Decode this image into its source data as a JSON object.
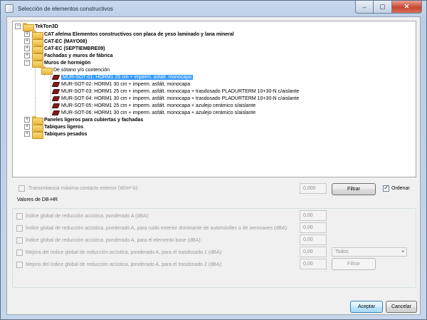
{
  "window": {
    "title": "Selección de elementos constructivos",
    "min_glyph": "–",
    "max_glyph": "▢",
    "close_glyph": "✕"
  },
  "tree": {
    "root": "TekTon3D",
    "categories": [
      "CAT afelma Elementos constructivos con placa de yeso laminado y lana mineral",
      "CAT-EC (MAYO08)",
      "CAT-EC (SEPTIEMBRE09)",
      "Fachadas y muros de fábrica",
      "Muros de hormigón"
    ],
    "subfolder": "De sótano y/o contención",
    "items": [
      "MUR-SOT-01: HORM1 25 cm + imperm. asfált. monocapa",
      "MUR-SOT-02: HORM1 30 cm + imperm. asfált. monocapa",
      "MUR-SOT-03: HORM1 25 cm + imperm. asfált. monocapa + trasdosado PLADURTERM 10+30-N c/aislante",
      "MUR-SOT-04: HORM1 30 cm + imperm. asfált. monocapa + trasdosado PLADURTERM 10+30-N c/aislante",
      "MUR-SOT-05: HORM1 25 cm + imperm. asfált. monocapa + azulejo cerámico s/aislante",
      "MUR-SOT-06: HORM1 30 cm + imperm. asfált. monocapa + azulejo cerámico s/aislante"
    ],
    "categories_after": [
      "Paneles ligeros para cubiertas y fachadas",
      "Tabiques ligeros",
      "Tabiques pesados"
    ],
    "expander_plus": "+",
    "expander_minus": "−"
  },
  "filter": {
    "transmitancia_label": "Transmitancia máxima contacto exterior (W/m²·k):",
    "transmitancia_value": "0,000",
    "filter_button": "Filtrar",
    "order_label": "Ordenar",
    "order_checked": true
  },
  "dbhr": {
    "group_title": "Valores de DB-HR",
    "rows": [
      {
        "label": "Índice global de reducción acústica, ponderado A (dBA):",
        "value": "0,00"
      },
      {
        "label": "Índice global de reducción acústica, ponderado A, para ruido exterior dominante de automóviles  o de aeronaves (dBA):",
        "value": "0,00"
      },
      {
        "label": "Índice global de reducción acústica, ponderado A, para el elemento base (dBA):",
        "value": "0,00"
      },
      {
        "label": "Mejora del índice global de reducción acústica, ponderado A, para el trasdosado 1 (dBA):",
        "value": "0,00"
      },
      {
        "label": "Mejora del índice global de reducción acústica, ponderado A, para el trasdosado 2 (dBA):",
        "value": "0,00"
      }
    ],
    "select_value": "Todos",
    "filter_button": "Filtrar"
  },
  "footer": {
    "accept_button": "Aceptar",
    "cancel_button": "Cancelar"
  },
  "colors": {
    "selection": "#3399ff",
    "item_icon": "#7b1c1c",
    "folder": "#f8dc7c"
  },
  "icons": {
    "folder": "folder-icon",
    "item": "construction-element-icon",
    "app": "app-icon"
  }
}
